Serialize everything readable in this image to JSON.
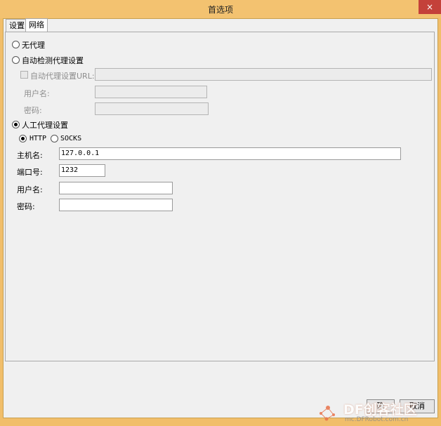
{
  "window": {
    "title": "首选项",
    "close_glyph": "×"
  },
  "tabs": [
    {
      "label": "设置"
    },
    {
      "label": "网络"
    }
  ],
  "no_proxy": {
    "label": "无代理"
  },
  "auto_detect": {
    "label": "自动检测代理设置"
  },
  "auto_url": {
    "label": "自动代理设置URL:",
    "value": ""
  },
  "auto_user": {
    "label": "用户名:",
    "value": ""
  },
  "auto_pass": {
    "label": "密码:",
    "value": ""
  },
  "manual": {
    "label": "人工代理设置"
  },
  "protocol": {
    "http": "HTTP",
    "socks": "SOCKS"
  },
  "host": {
    "label": "主机名:",
    "value": "127.0.0.1"
  },
  "port": {
    "label": "端口号:",
    "value": "1232"
  },
  "user": {
    "label": "用户名:",
    "value": ""
  },
  "pass": {
    "label": "密码:",
    "value": ""
  },
  "buttons": {
    "ok": "确",
    "cancel": "取消"
  },
  "watermark": {
    "brand": "DF创客社区",
    "site": "mc.DFRobot.com.cn",
    "brand_color": "#e8724a"
  }
}
